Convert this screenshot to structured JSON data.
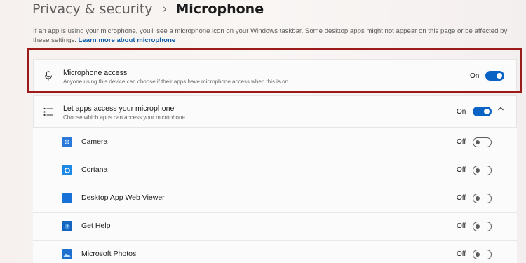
{
  "breadcrumb": {
    "parent": "Privacy & security",
    "separator": "›",
    "current": "Microphone"
  },
  "description": {
    "text": "If an app is using your microphone, you'll see a microphone icon on your Windows taskbar. Some desktop apps might not appear on this page or be affected by these settings.",
    "link": "Learn more about microphone"
  },
  "microphone_access": {
    "title": "Microphone access",
    "subtitle": "Anyone using this device can choose if their apps have microphone access when this is on",
    "state": "On",
    "icon": "microphone-icon"
  },
  "let_apps": {
    "title": "Let apps access your microphone",
    "subtitle": "Choose which apps can access your microphone",
    "state": "On",
    "icon": "list-icon",
    "expand_icon": "chevron-up-icon"
  },
  "apps": [
    {
      "name": "Camera",
      "state": "Off",
      "icon": "camera-app-icon"
    },
    {
      "name": "Cortana",
      "state": "Off",
      "icon": "cortana-app-icon"
    },
    {
      "name": "Desktop App Web Viewer",
      "state": "Off",
      "icon": "web-viewer-app-icon"
    },
    {
      "name": "Get Help",
      "state": "Off",
      "icon": "get-help-app-icon"
    },
    {
      "name": "Microsoft Photos",
      "state": "Off",
      "icon": "photos-app-icon"
    }
  ],
  "colors": {
    "accent": "#0a62c5",
    "highlight_border": "#9b1b1b"
  }
}
